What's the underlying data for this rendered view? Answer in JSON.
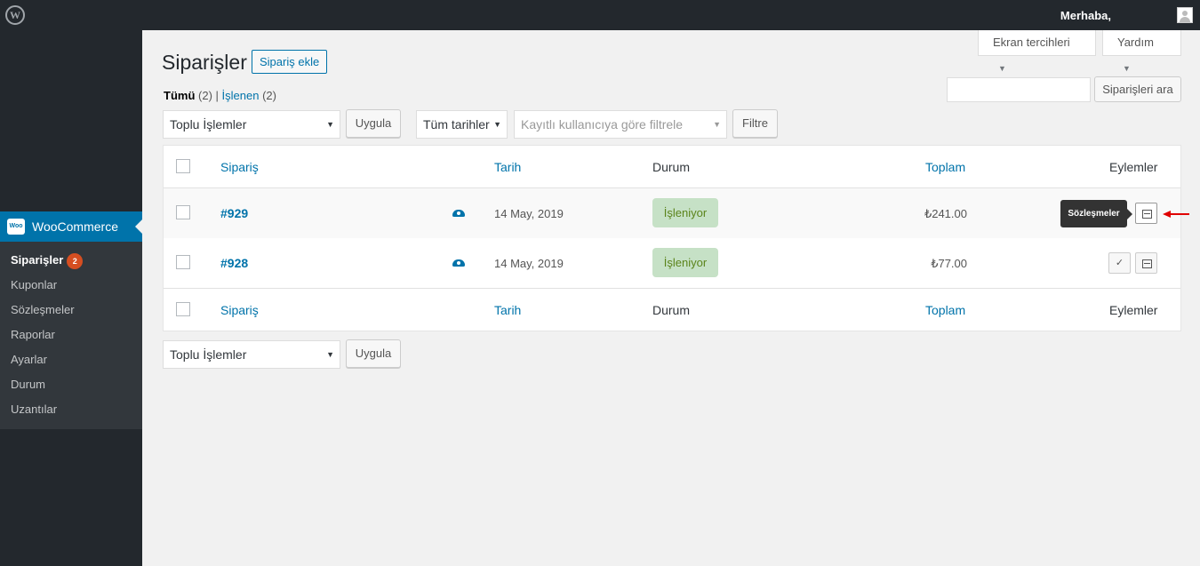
{
  "adminbar": {
    "greeting": "Merhaba,"
  },
  "sidebar": {
    "woocommerce_label": "WooCommerce",
    "woo_icon_text": "Woo",
    "items": [
      {
        "label": "Siparişler",
        "badge": "2"
      },
      {
        "label": "Kuponlar"
      },
      {
        "label": "Sözleşmeler"
      },
      {
        "label": "Raporlar"
      },
      {
        "label": "Ayarlar"
      },
      {
        "label": "Durum"
      },
      {
        "label": "Uzantılar"
      }
    ]
  },
  "screen_meta": {
    "screen_options": "Ekran tercihleri",
    "help": "Yardım"
  },
  "page": {
    "title": "Siparişler",
    "add_button": "Sipariş ekle"
  },
  "views": {
    "all": {
      "label": "Tümü",
      "count": "(2)"
    },
    "separator": "|",
    "processing": {
      "label": "İşlenen",
      "count": "(2)"
    }
  },
  "search": {
    "value": "",
    "button": "Siparişleri ara"
  },
  "filters": {
    "bulk_actions": "Toplu İşlemler",
    "apply": "Uygula",
    "dates": "Tüm tarihler",
    "customer_placeholder": "Kayıtlı kullanıcıya göre filtrele",
    "filter_button": "Filtre"
  },
  "table": {
    "columns": {
      "order": "Sipariş",
      "date": "Tarih",
      "status": "Durum",
      "total": "Toplam",
      "actions": "Eylemler"
    },
    "rows": [
      {
        "order": "#929",
        "date": "14 May, 2019",
        "status": "İşleniyor",
        "total": "₺241.00"
      },
      {
        "order": "#928",
        "date": "14 May, 2019",
        "status": "İşleniyor",
        "total": "₺77.00"
      }
    ]
  },
  "tooltip": {
    "text": "Sözleşmeler"
  },
  "colors": {
    "accent": "#0073aa",
    "status_bg": "#c6e1c6",
    "status_text": "#5b841b",
    "badge": "#d54e21",
    "arrow": "#e00000"
  }
}
